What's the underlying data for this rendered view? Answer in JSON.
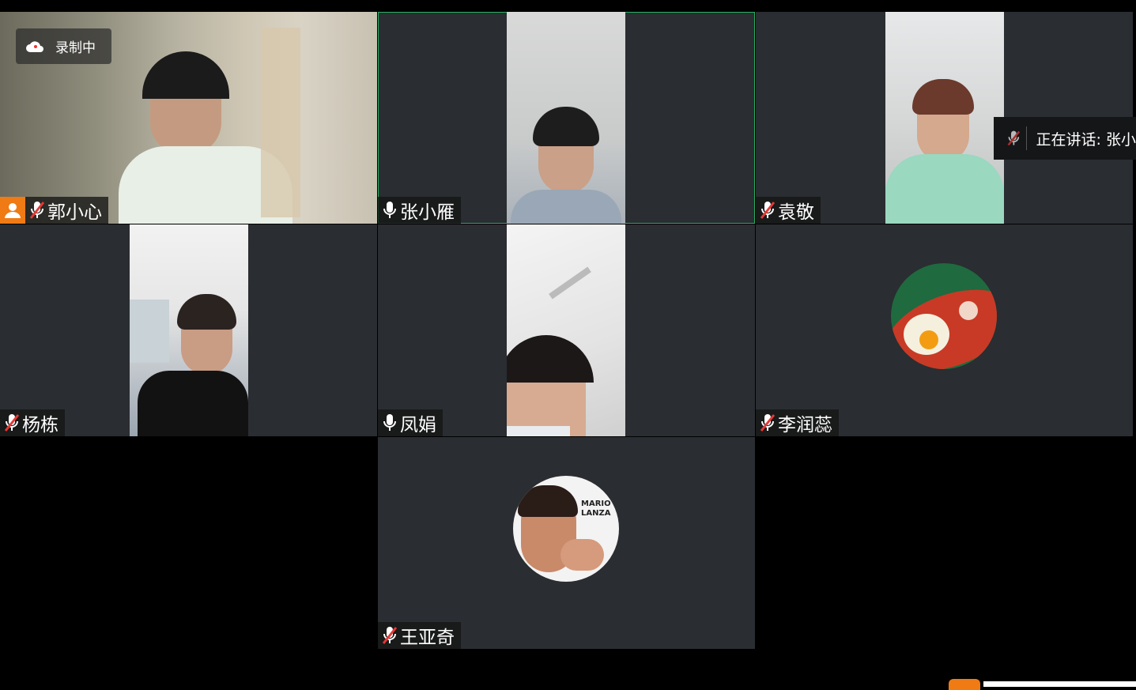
{
  "recording": {
    "label": "录制中",
    "icon": "cloud-icon"
  },
  "speaking_indicator": {
    "label": "正在讲话: 张小",
    "icon": "mic-muted-icon"
  },
  "participants": [
    {
      "name": "郭小心",
      "mic": "muted",
      "host": true,
      "mode": "video"
    },
    {
      "name": "张小雁",
      "mic": "on",
      "mode": "video",
      "active_speaker": true
    },
    {
      "name": "袁敬",
      "mic": "muted",
      "mode": "video"
    },
    {
      "name": "杨栋",
      "mic": "muted",
      "mode": "video"
    },
    {
      "name": "凤娟",
      "mic": "on",
      "mode": "video"
    },
    {
      "name": "李润蕊",
      "mic": "muted",
      "mode": "avatar"
    },
    {
      "name": "王亚奇",
      "mic": "muted",
      "mode": "avatar",
      "avatar_text": "MARIO LANZA"
    }
  ],
  "colors": {
    "tile_bg": "#2a2d31",
    "active_border": "#27b063",
    "host_badge": "#f07a13",
    "muted_slash": "#e53935"
  }
}
